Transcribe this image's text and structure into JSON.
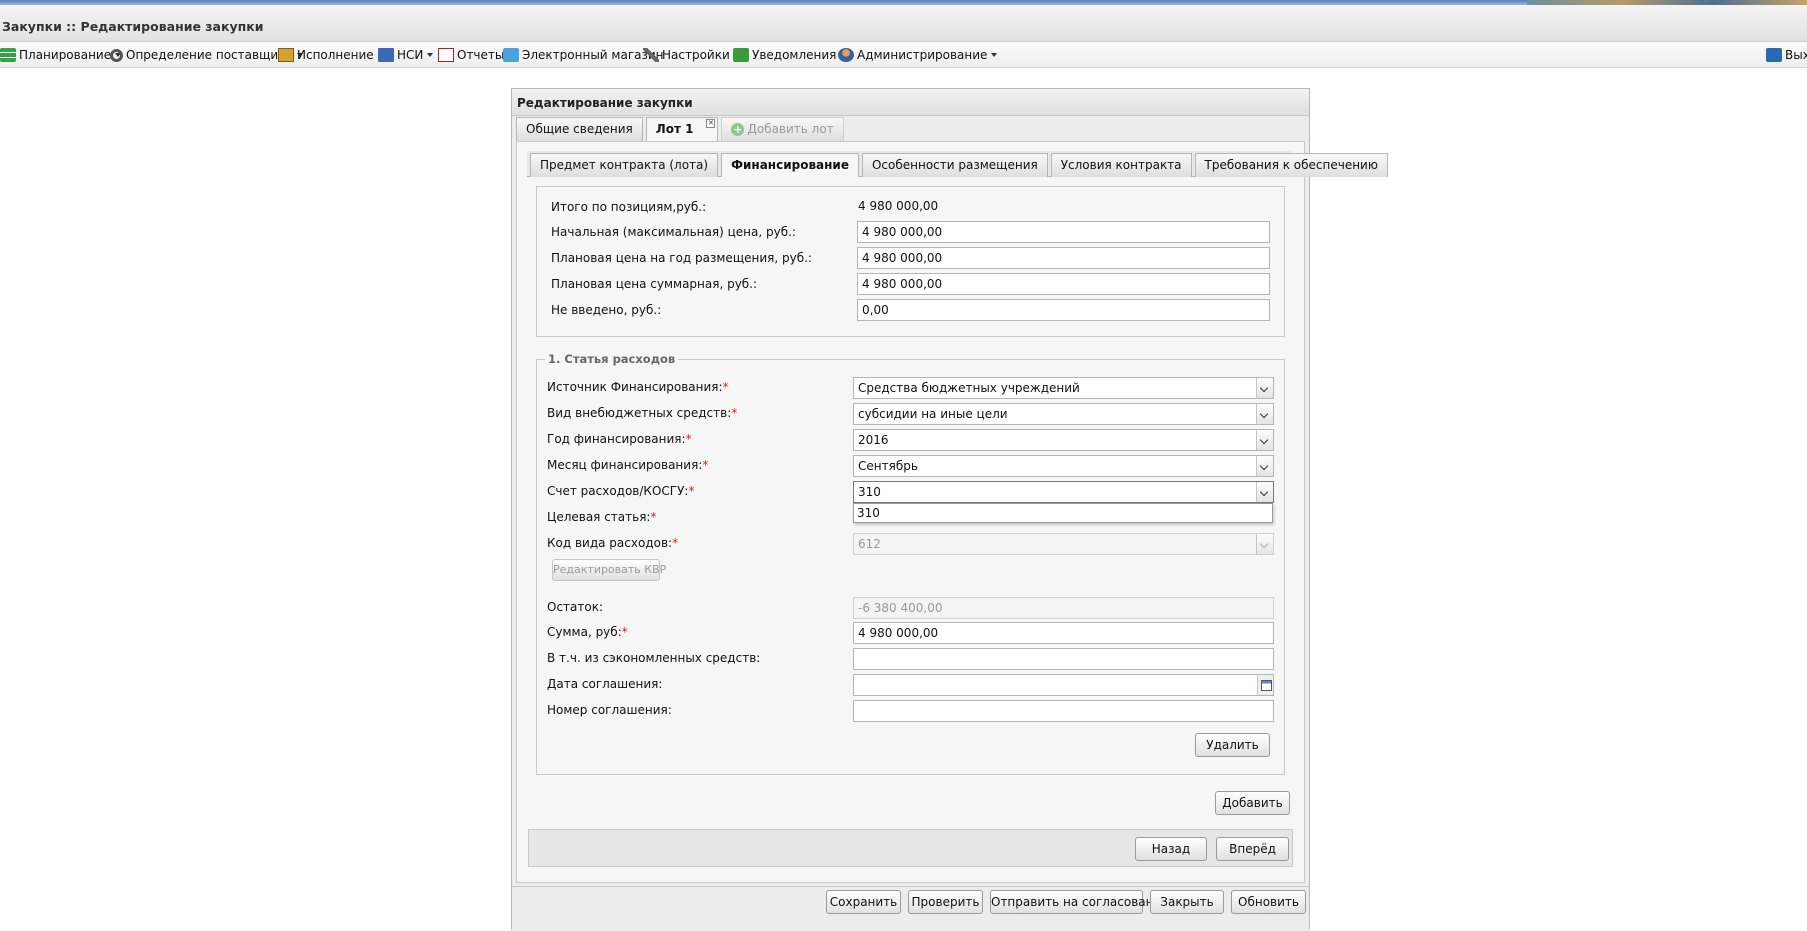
{
  "window_title": "Закупки :: Редактирование закупки",
  "menu": [
    {
      "label": "Планирование",
      "icon": "planning-icon",
      "dropdown": true
    },
    {
      "label": "Определение поставщика",
      "icon": "gear-icon",
      "dropdown": true
    },
    {
      "label": "Исполнение",
      "icon": "box-icon",
      "dropdown": true
    },
    {
      "label": "НСИ",
      "icon": "book-icon",
      "dropdown": true
    },
    {
      "label": "Отчеты",
      "icon": "report-icon",
      "dropdown": false
    },
    {
      "label": "Электронный магазин",
      "icon": "cart-icon",
      "dropdown": false
    },
    {
      "label": "Настройки",
      "icon": "wrench-icon",
      "dropdown": true
    },
    {
      "label": "Уведомления",
      "icon": "bell-icon",
      "dropdown": true
    },
    {
      "label": "Администрирование",
      "icon": "user-icon",
      "dropdown": true
    }
  ],
  "exit_label": "Вых",
  "panel_title": "Редактирование закупки",
  "main_tabs": [
    "Общие сведения",
    "Лот 1",
    "Добавить лот"
  ],
  "sub_tabs": [
    "Предмет контракта (лота)",
    "Финансирование",
    "Особенности размещения",
    "Условия контракта",
    "Требования к обеспечению"
  ],
  "totals": {
    "total_label": "Итого по позициям,руб.:",
    "total_value": "4 980 000,00",
    "nmc_label": "Начальная (максимальная) цена, руб.:",
    "nmc_value": "4 980 000,00",
    "plan_year_label": "Плановая цена на год размещения, руб.:",
    "plan_year_value": "4 980 000,00",
    "plan_sum_label": "Плановая цена суммарная, руб.:",
    "plan_sum_value": "4 980 000,00",
    "not_entered_label": "Не введено, руб.:",
    "not_entered_value": "0,00"
  },
  "expense": {
    "legend": "1. Статья расходов",
    "source_label": "Источник Финансирования:",
    "source_value": "Средства бюджетных учреждений",
    "kind_label": "Вид внебюджетных средств:",
    "kind_value": "субсидии на иные цели",
    "year_label": "Год финансирования:",
    "year_value": "2016",
    "month_label": "Месяц финансирования:",
    "month_value": "Сентябрь",
    "account_label": "Счет расходов/КОСГУ:",
    "account_value": "310",
    "account_option": "310",
    "target_label": "Целевая статья:",
    "kvr_label": "Код вида расходов:",
    "kvr_value": "612",
    "edit_kvr": "Редактировать КВР",
    "rest_label": "Остаток:",
    "rest_value": "-6 380 400,00",
    "sum_label": "Сумма, руб:",
    "sum_value": "4 980 000,00",
    "saved_label": "В т.ч. из сэкономленных средств:",
    "saved_value": "",
    "date_label": "Дата соглашения:",
    "date_value": "",
    "number_label": "Номер соглашения:",
    "number_value": "",
    "delete": "Удалить",
    "required_mark": "*"
  },
  "add": "Добавить",
  "back": "Назад",
  "forward": "Вперёд",
  "footer": [
    "Сохранить",
    "Проверить",
    "Отправить на согласование",
    "Закрыть",
    "Обновить"
  ]
}
